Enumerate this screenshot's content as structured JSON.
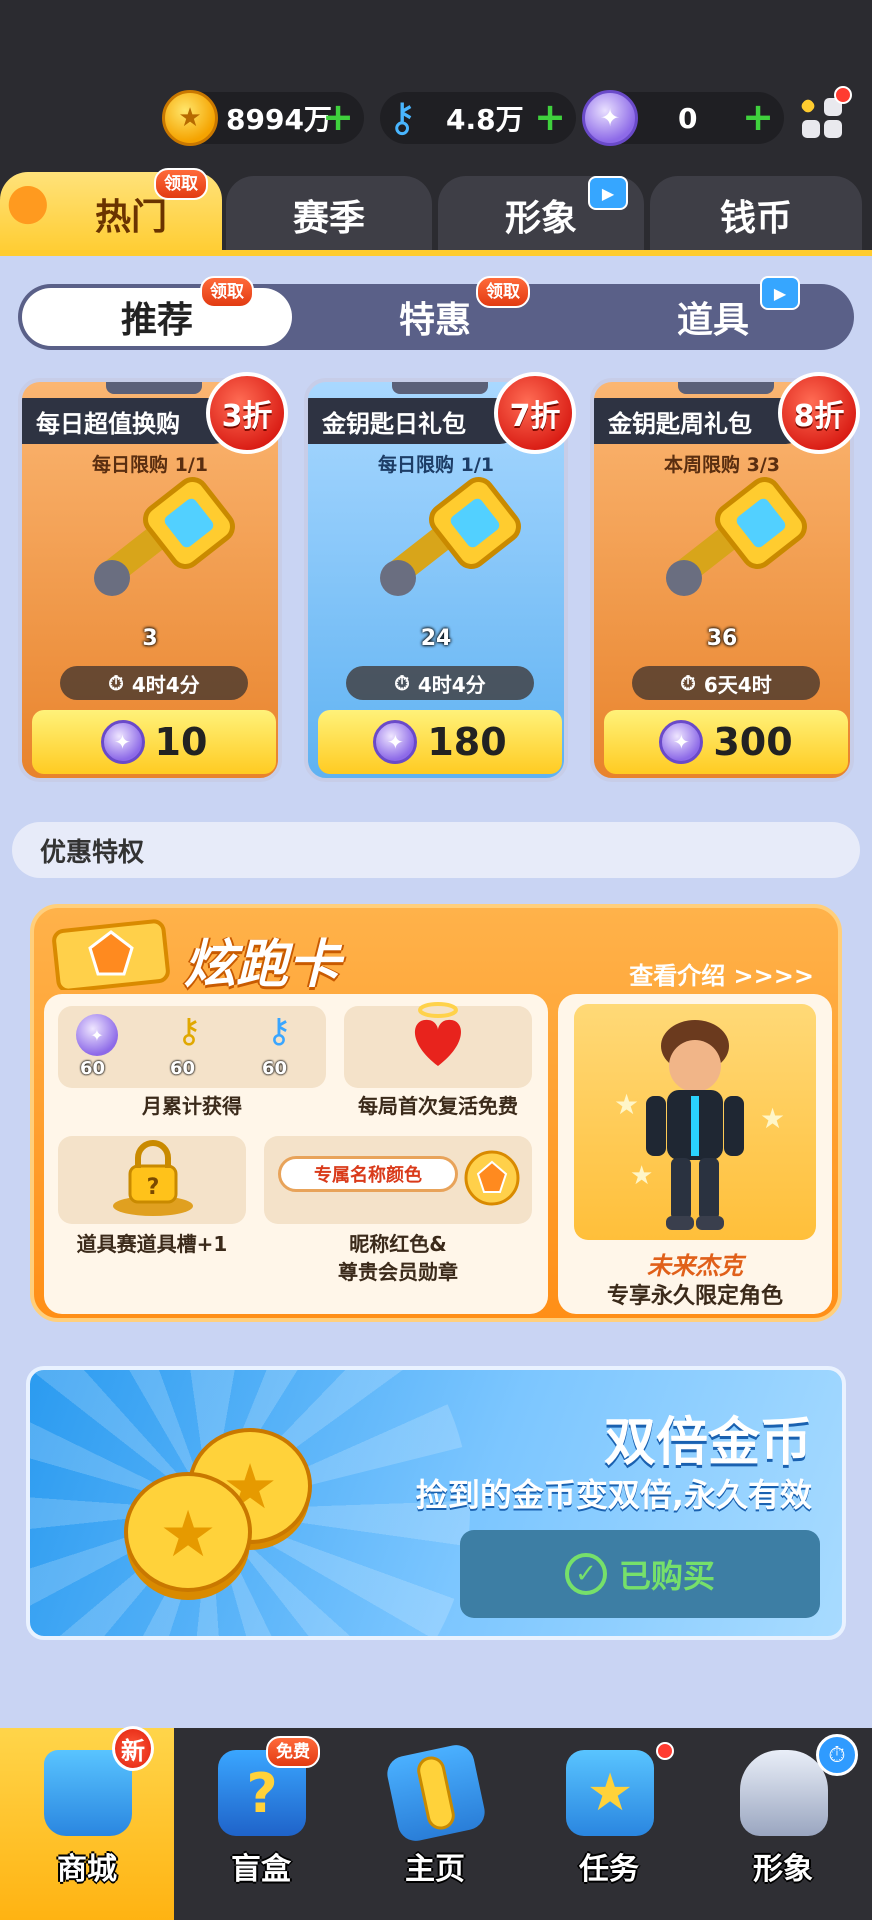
{
  "currencies": {
    "coins": "8994万",
    "keys": "4.8万",
    "gems": "0",
    "plus": "+"
  },
  "top_tabs": [
    {
      "label": "热门",
      "badge": "领取"
    },
    {
      "label": "赛季"
    },
    {
      "label": "形象"
    },
    {
      "label": "钱币"
    }
  ],
  "sub_tabs": [
    {
      "label": "推荐",
      "badge": "领取"
    },
    {
      "label": "特惠",
      "badge": "领取"
    },
    {
      "label": "道具"
    }
  ],
  "offers": [
    {
      "title": "每日超值换购",
      "limit": "每日限购 1/1",
      "qty": "3",
      "timer": "4时4分",
      "price": "10",
      "discount": "3折"
    },
    {
      "title": "金钥匙日礼包",
      "limit": "每日限购 1/1",
      "qty": "24",
      "timer": "4时4分",
      "price": "180",
      "discount": "7折"
    },
    {
      "title": "金钥匙周礼包",
      "limit": "本周限购 3/3",
      "qty": "36",
      "timer": "6天4时",
      "price": "300",
      "discount": "8折"
    }
  ],
  "section_title": "优惠特权",
  "pass": {
    "title": "炫跑卡",
    "more": "查看介绍 >>>>",
    "perks": [
      {
        "label": "月累计获得",
        "counts": [
          "60",
          "60",
          "60"
        ]
      },
      {
        "label": "每局首次复活免费"
      },
      {
        "label": "道具赛道具槽+1"
      },
      {
        "label_line1": "昵称红色&",
        "label_line2": "尊贵会员勋章",
        "tag": "专属名称颜色"
      }
    ],
    "hero_name": "未来杰克",
    "hero_desc": "专享永久限定角色"
  },
  "double_coins": {
    "title": "双倍金币",
    "desc": "捡到的金币变双倍,永久有效",
    "button": "已购买"
  },
  "nav": [
    {
      "label": "商城",
      "badge": "新"
    },
    {
      "label": "盲盒",
      "badge": "免费"
    },
    {
      "label": "主页"
    },
    {
      "label": "任务"
    },
    {
      "label": "形象"
    }
  ],
  "colors": {
    "accent_gold": "#ffcc2f",
    "discount_red": "#d91c14",
    "bought_green": "#76e06a"
  }
}
